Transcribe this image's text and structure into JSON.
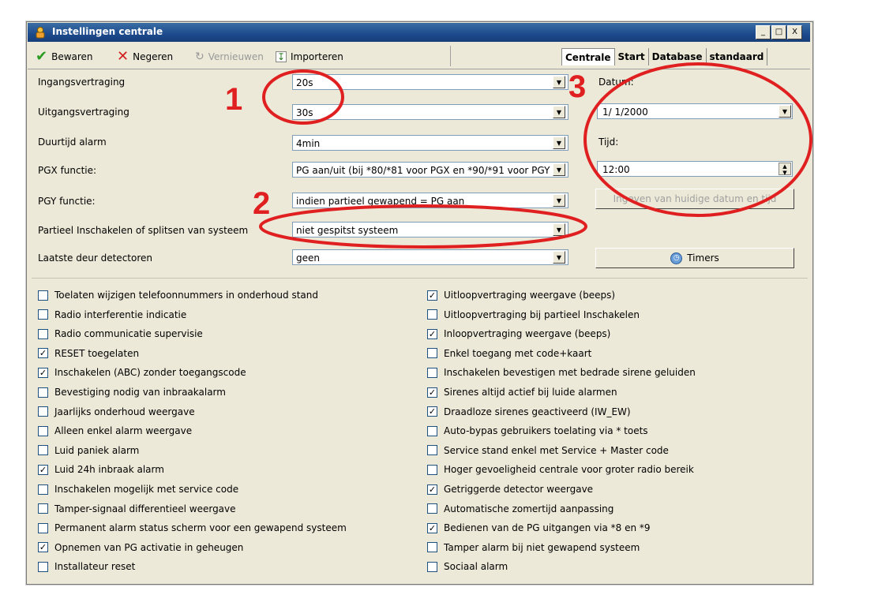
{
  "window": {
    "title": "Instellingen centrale",
    "controls": [
      "_",
      "□",
      "X"
    ]
  },
  "toolbar": {
    "save_label": "Bewaren",
    "discard_label": "Negeren",
    "refresh_label": "Vernieuwen",
    "import_label": "Importeren"
  },
  "tabs": [
    "Centrale",
    "Start",
    "Database",
    "standaard"
  ],
  "settings": [
    {
      "label": "Ingangsvertraging",
      "value": "20s"
    },
    {
      "label": "Uitgangsvertraging",
      "value": "30s"
    },
    {
      "label": "Duurtijd alarm",
      "value": "4min"
    },
    {
      "label": "PGX functie:",
      "value": "PG aan/uit (bij *80/*81 voor PGX en *90/*91 voor PGY"
    },
    {
      "label": "PGY functie:",
      "value": "indien partieel gewapend = PG aan"
    },
    {
      "label": "Partieel Inschakelen of splitsen van systeem",
      "value": "niet gespitst systeem"
    },
    {
      "label": "Laatste deur detectoren",
      "value": "geen"
    }
  ],
  "datetime": {
    "date_label": "Datum:",
    "date_value": "1/  1/2000",
    "time_label": "Tijd:",
    "time_value": "12:00",
    "set_button": "Ingeven van huidige datum en tijd",
    "timers_button": "Timers"
  },
  "annotations": [
    "1",
    "2",
    "3"
  ],
  "checkboxes_left": [
    {
      "label": "Toelaten wijzigen telefoonnummers in onderhoud stand",
      "checked": false
    },
    {
      "label": "Radio interferentie indicatie",
      "checked": false
    },
    {
      "label": "Radio communicatie supervisie",
      "checked": false
    },
    {
      "label": "RESET toegelaten",
      "checked": true
    },
    {
      "label": "Inschakelen (ABC) zonder toegangscode",
      "checked": true
    },
    {
      "label": "Bevestiging nodig van inbraakalarm",
      "checked": false
    },
    {
      "label": "Jaarlijks onderhoud weergave",
      "checked": false
    },
    {
      "label": "Alleen enkel alarm weergave",
      "checked": false
    },
    {
      "label": "Luid paniek alarm",
      "checked": false
    },
    {
      "label": "Luid 24h inbraak alarm",
      "checked": true
    },
    {
      "label": "Inschakelen mogelijk met service code",
      "checked": false
    },
    {
      "label": "Tamper-signaal differentieel weergave",
      "checked": false
    },
    {
      "label": "Permanent alarm status scherm voor een gewapend systeem",
      "checked": false
    },
    {
      "label": "Opnemen van PG activatie in geheugen",
      "checked": true
    },
    {
      "label": "Installateur reset",
      "checked": false
    }
  ],
  "checkboxes_right": [
    {
      "label": "Uitloopvertraging weergave (beeps)",
      "checked": true
    },
    {
      "label": "Uitloopvertraging bij partieel Inschakelen",
      "checked": false
    },
    {
      "label": "Inloopvertraging weergave (beeps)",
      "checked": true
    },
    {
      "label": "Enkel toegang met code+kaart",
      "checked": false
    },
    {
      "label": "Inschakelen bevestigen met bedrade sirene geluiden",
      "checked": false
    },
    {
      "label": "Sirenes altijd actief bij luide alarmen",
      "checked": true
    },
    {
      "label": "Draadloze sirenes geactiveerd (IW_EW)",
      "checked": true
    },
    {
      "label": "Auto-bypas gebruikers toelating via * toets",
      "checked": false
    },
    {
      "label": "Service stand enkel met Service + Master code",
      "checked": false
    },
    {
      "label": "Hoger gevoeligheid centrale voor groter radio bereik",
      "checked": false
    },
    {
      "label": "Getriggerde detector weergave",
      "checked": true
    },
    {
      "label": "Automatische zomertijd aanpassing",
      "checked": false
    },
    {
      "label": "Bedienen van de PG uitgangen via *8 en *9",
      "checked": true
    },
    {
      "label": "Tamper alarm bij niet gewapend systeem",
      "checked": false
    },
    {
      "label": "Sociaal alarm",
      "checked": false
    }
  ],
  "colors": {
    "titlebar": "#1d4a8c",
    "annotation": "#e02020",
    "window_bg": "#ece9d8"
  }
}
